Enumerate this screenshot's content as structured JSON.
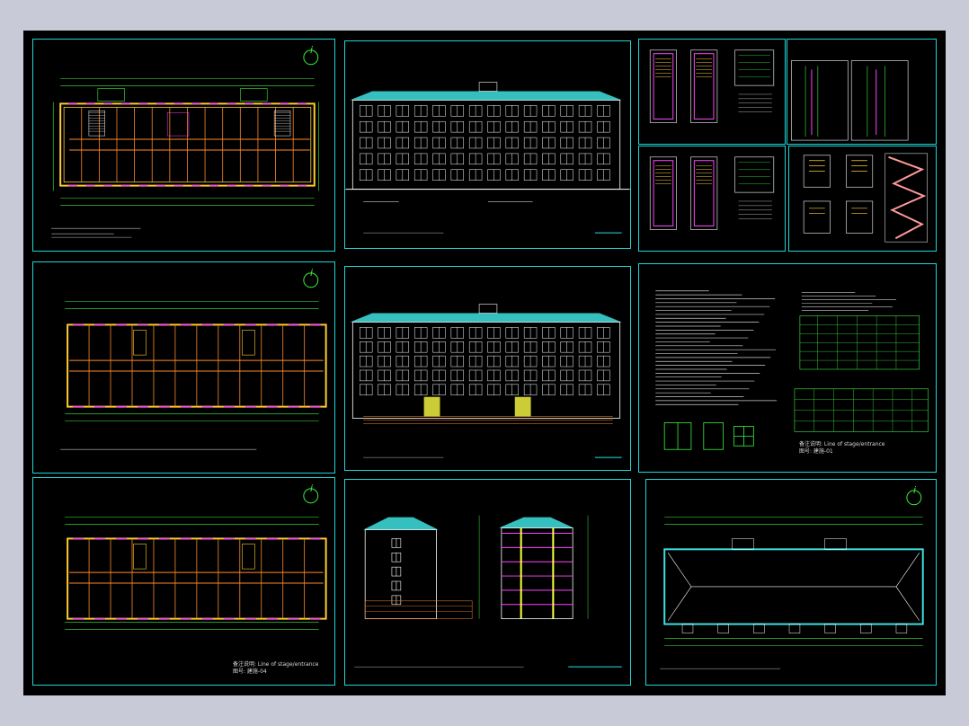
{
  "app": {
    "background": "#c9cad8",
    "canvas_background": "#000000"
  },
  "colors": {
    "border": "#1fd6d6",
    "wall": "#ffcc33",
    "dim": "#3cf03c",
    "axis": "#ff8a2a",
    "window": "#ff44ff",
    "roof": "#3ee0e0",
    "line": "#ffffff"
  },
  "icons": {
    "north": "north-arrow-icon"
  },
  "sheets": {
    "plan_1": {
      "north_label": "i"
    },
    "plan_2": {
      "north_label": "i"
    },
    "plan_3": {
      "north_label": "i",
      "note": "备注说明: Line of stage/entrance",
      "note2": "图号: 建施-04"
    },
    "roof": {
      "north_label": "i"
    },
    "notes": {
      "title_block": "备注说明: Line of stage/entrance",
      "title_block2": "图号: 建施-01"
    }
  }
}
